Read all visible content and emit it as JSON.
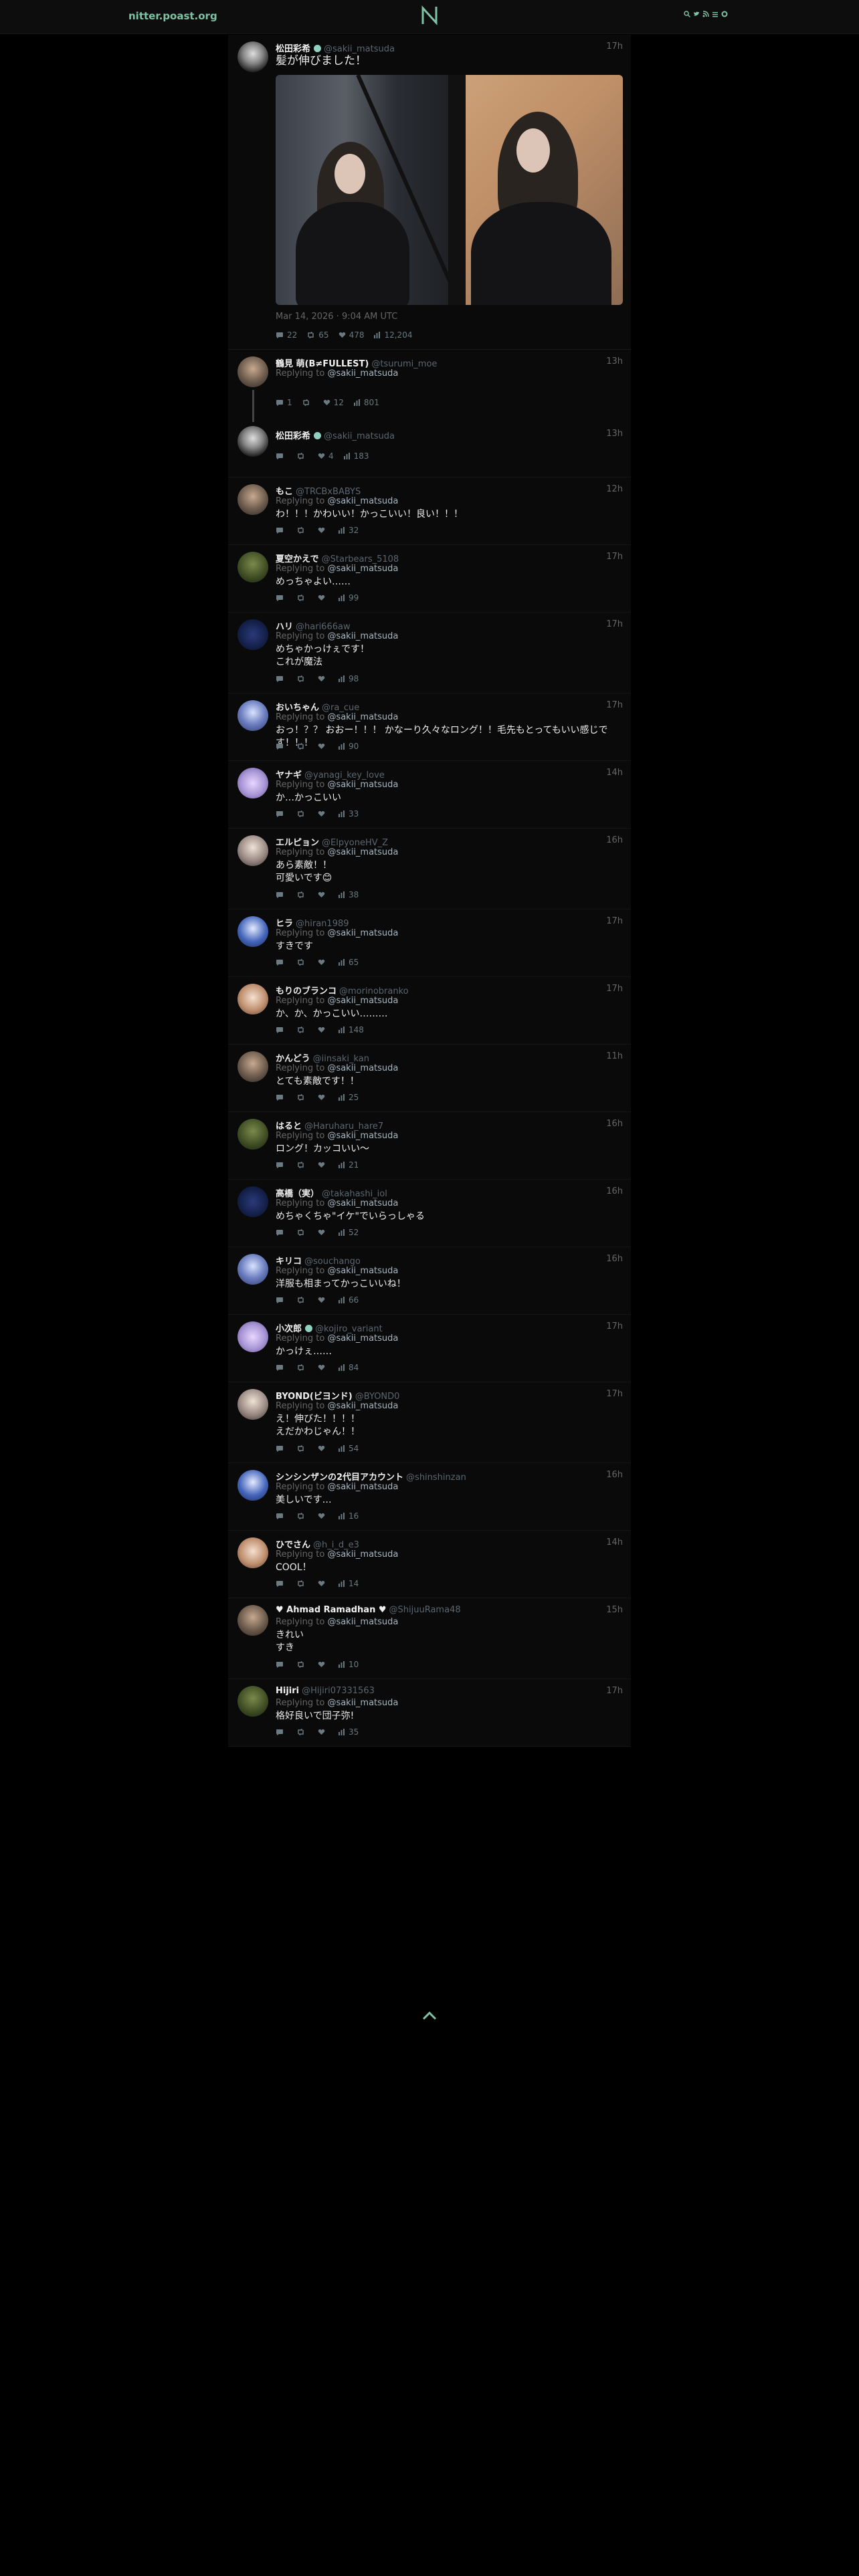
{
  "nav": {
    "brand": "nitter.poast.org"
  },
  "main_tweet": {
    "fullname": "松田彩希",
    "username": "@sakii_matsuda",
    "time": "17h",
    "text": "髪が伸びました！",
    "date": "Mar 14, 2026 · 9:04 AM UTC",
    "stats": {
      "replies": "22",
      "retweets": "65",
      "likes": "478",
      "views": "12,204"
    }
  },
  "thread": [
    {
      "fullname": "鶴見 萌(B≠FULLEST)",
      "username": "@tsurumi_moe",
      "time": "13h",
      "replying_label": "Replying to",
      "replying_to": "@sakii_matsuda",
      "stats": {
        "replies": "1",
        "retweets": "",
        "likes": "12",
        "views": "801"
      }
    },
    {
      "fullname": "松田彩希",
      "username": "@sakii_matsuda",
      "time": "13h",
      "stats": {
        "replies": "",
        "retweets": "",
        "likes": "4",
        "views": "183"
      }
    }
  ],
  "replies": [
    {
      "fullname": "もこ",
      "username": "@TRCBxBABYS",
      "time": "12h",
      "replying_label": "Replying to",
      "replying_to": "@sakii_matsuda",
      "text": "わ！！！かわいい！かっこいい！良い！！！",
      "views": "32"
    },
    {
      "fullname": "夏空かえで",
      "username": "@Starbears_5108",
      "time": "17h",
      "replying_label": "Replying to",
      "replying_to": "@sakii_matsuda",
      "text": "めっちゃよい……",
      "views": "99"
    },
    {
      "fullname": "ハリ",
      "username": "@hari666aw",
      "time": "17h",
      "replying_label": "Replying to",
      "replying_to": "@sakii_matsuda",
      "text": "めちゃかっけぇです！\nこれが魔法",
      "views": "98"
    },
    {
      "fullname": "おいちゃん",
      "username": "@ra_cue",
      "time": "17h",
      "replying_label": "Replying to",
      "replying_to": "@sakii_matsuda",
      "text": "おっ！？？ おおー！！！ かなーり久々なロング！！毛先もとってもいい感じです！！！",
      "views": "90"
    },
    {
      "fullname": "ヤナギ",
      "username": "@yanagi_key_love",
      "time": "14h",
      "replying_label": "Replying to",
      "replying_to": "@sakii_matsuda",
      "text": "か…かっこいい",
      "views": "33"
    },
    {
      "fullname": "エルピョン",
      "username": "@ElpyoneHV_Z",
      "time": "16h",
      "replying_label": "Replying to",
      "replying_to": "@sakii_matsuda",
      "text": "あら素敵！！\n可愛いです😊",
      "views": "38"
    },
    {
      "fullname": "ヒラ",
      "username": "@hiran1989",
      "time": "17h",
      "replying_label": "Replying to",
      "replying_to": "@sakii_matsuda",
      "text": "すきです",
      "views": "65"
    },
    {
      "fullname": "もりのブランコ",
      "username": "@morinobranko",
      "time": "17h",
      "replying_label": "Replying to",
      "replying_to": "@sakii_matsuda",
      "text": "か、か、かっこいい………",
      "views": "148"
    },
    {
      "fullname": "かんどう",
      "username": "@iinsaki_kan",
      "time": "11h",
      "replying_label": "Replying to",
      "replying_to": "@sakii_matsuda",
      "text": "とても素敵です！！",
      "views": "25"
    },
    {
      "fullname": "はると",
      "username": "@Haruharu_hare7",
      "time": "16h",
      "replying_label": "Replying to",
      "replying_to": "@sakii_matsuda",
      "text": "ロング！カッコいい〜",
      "views": "21"
    },
    {
      "fullname": "高橋（実）",
      "username": "@takahashi_iol",
      "time": "16h",
      "replying_label": "Replying to",
      "replying_to": "@sakii_matsuda",
      "text": "めちゃくちゃ\"イケ\"でいらっしゃる",
      "views": "52"
    },
    {
      "fullname": "キリコ",
      "username": "@souchango",
      "time": "16h",
      "replying_label": "Replying to",
      "replying_to": "@sakii_matsuda",
      "text": "洋服も相まってかっこいいね！",
      "views": "66"
    },
    {
      "fullname": "小次郎",
      "username": "@kojiro_variant",
      "time": "17h",
      "replying_label": "Replying to",
      "replying_to": "@sakii_matsuda",
      "text": "かっけぇ……",
      "views": "84"
    },
    {
      "fullname": "BYOND(ビヨンド)",
      "username": "@BYOND0",
      "time": "17h",
      "replying_label": "Replying to",
      "replying_to": "@sakii_matsuda",
      "text": "え！伸びた！！！！\nえだかわじゃん！！",
      "views": "54"
    },
    {
      "fullname": "シンシンザンの2代目アカウント",
      "username": "@shinshinzan",
      "time": "16h",
      "replying_label": "Replying to",
      "replying_to": "@sakii_matsuda",
      "text": "美しいです…",
      "views": "16"
    },
    {
      "fullname": "ひでさん",
      "username": "@h_i_d_e3",
      "time": "14h",
      "replying_label": "Replying to",
      "replying_to": "@sakii_matsuda",
      "text": "COOL！",
      "views": "14"
    },
    {
      "fullname": "♥ Ahmad Ramadhan ♥",
      "username": "@ShijuuRama48",
      "time": "15h",
      "replying_label": "Replying to",
      "replying_to": "@sakii_matsuda",
      "text": "きれい\nすき",
      "views": "10"
    },
    {
      "fullname": "Hijiri",
      "username": "@Hijiri07331563",
      "time": "17h",
      "replying_label": "Replying to",
      "replying_to": "@sakii_matsuda",
      "text": "格好良いで団子弥!",
      "views": "35"
    }
  ],
  "icons": [
    "search-icon",
    "rss-icon",
    "list-icon",
    "settings-icon",
    "comment-icon",
    "retweet-icon",
    "heart-icon",
    "views-icon",
    "chevron-up-icon"
  ],
  "colors": {
    "accent": "#7ec3a6",
    "mention": "#a7b7c2",
    "muted": "#666666",
    "background": "#000000"
  }
}
